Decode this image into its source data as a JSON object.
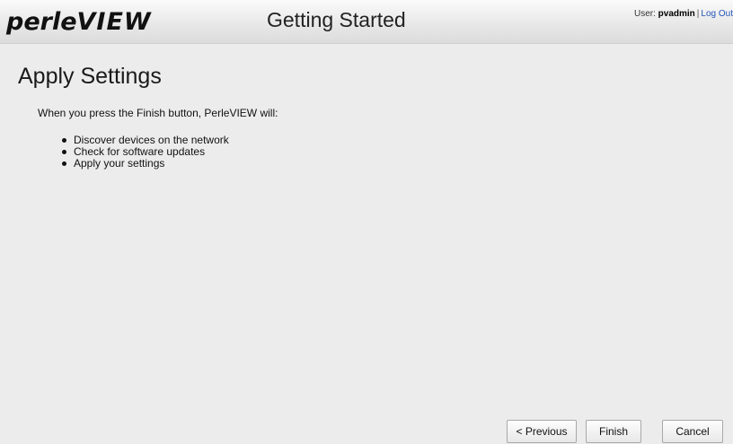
{
  "header": {
    "logo_prefix": "perle",
    "logo_suffix": "VIEW",
    "page_heading": "Getting Started",
    "user_label": "User:",
    "user_name": "pvadmin",
    "separator": "|",
    "logout_label": "Log Out"
  },
  "main": {
    "title": "Apply Settings",
    "intro": "When you press the Finish button, PerleVIEW will:",
    "actions": [
      "Discover devices on the network",
      "Check for software updates",
      "Apply your settings"
    ]
  },
  "footer": {
    "previous_label": "< Previous",
    "finish_label": "Finish",
    "cancel_label": "Cancel"
  }
}
